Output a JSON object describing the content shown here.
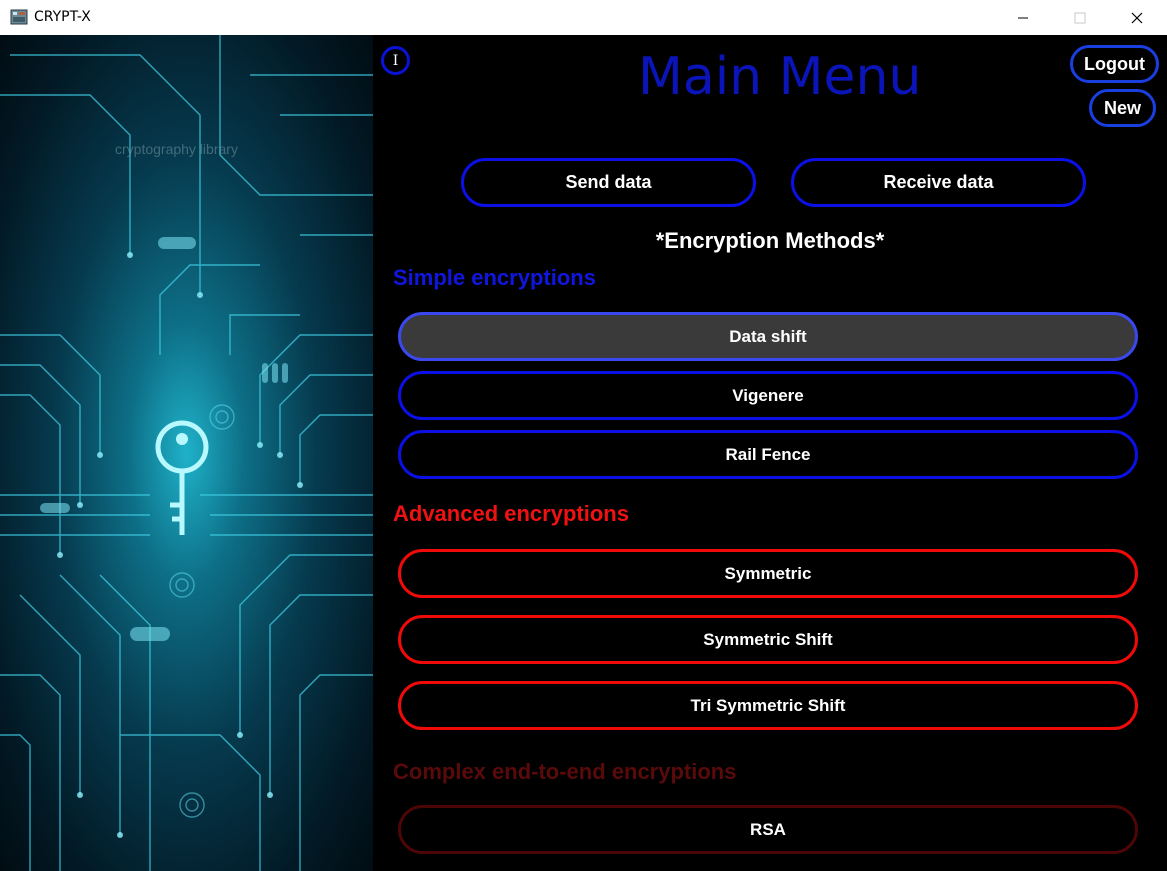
{
  "window": {
    "title": "CRYPT-X"
  },
  "side_panel": {
    "watermark": "cryptography library"
  },
  "header": {
    "info_label": "I",
    "title": "Main Menu",
    "logout_label": "Logout",
    "new_label": "New"
  },
  "actions": {
    "send_label": "Send data",
    "receive_label": "Receive data"
  },
  "section_heading": "*Encryption Methods*",
  "groups": {
    "simple": {
      "label": "Simple encryptions",
      "color": "#1016e0",
      "items": [
        "Data shift",
        "Vigenere",
        "Rail Fence"
      ],
      "selected": "Data shift"
    },
    "advanced": {
      "label": "Advanced encryptions",
      "color": "#f01212",
      "items": [
        "Symmetric",
        "Symmetric Shift",
        "Tri Symmetric Shift"
      ]
    },
    "complex": {
      "label": "Complex end-to-end encryptions",
      "color": "#5a0a0a",
      "items": [
        "RSA"
      ]
    }
  }
}
